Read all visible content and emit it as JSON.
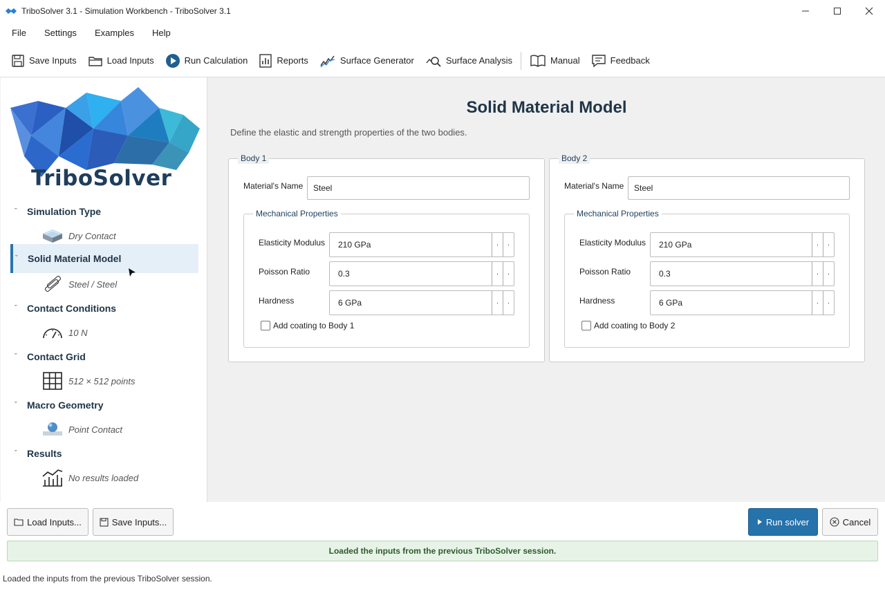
{
  "window": {
    "title": "TriboSolver 3.1 - Simulation Workbench - TriboSolver 3.1"
  },
  "menu": [
    "File",
    "Settings",
    "Examples",
    "Help"
  ],
  "toolbar": {
    "save_inputs": "Save Inputs",
    "load_inputs": "Load Inputs",
    "run_calculation": "Run Calculation",
    "reports": "Reports",
    "surface_generator": "Surface Generator",
    "surface_analysis": "Surface Analysis",
    "manual": "Manual",
    "feedback": "Feedback"
  },
  "logo": {
    "text": "TriboSolver"
  },
  "sidebar": {
    "sections": [
      {
        "label": "Simulation Type",
        "value": "Dry Contact",
        "icon": "contact-block-icon"
      },
      {
        "label": "Solid Material Model",
        "value": "Steel / Steel",
        "icon": "material-bars-icon",
        "active": true
      },
      {
        "label": "Contact Conditions",
        "value": "10 N",
        "icon": "gauge-icon"
      },
      {
        "label": "Contact Grid",
        "value": "512 × 512 points",
        "icon": "grid-icon"
      },
      {
        "label": "Macro Geometry",
        "value": "Point Contact",
        "icon": "sphere-icon"
      },
      {
        "label": "Results",
        "value": "No results loaded",
        "icon": "chart-icon"
      }
    ]
  },
  "main": {
    "title": "Solid Material Model",
    "description": "Define the elastic and strength properties of the two bodies.",
    "bodies": [
      {
        "legend": "Body 1",
        "name_label": "Material's Name",
        "name_value": "Steel",
        "props_legend": "Mechanical Properties",
        "elasticity_label": "Elasticity Modulus",
        "elasticity_value": "210 GPa",
        "poisson_label": "Poisson Ratio",
        "poisson_value": "0.3",
        "hardness_label": "Hardness",
        "hardness_value": "6 GPa",
        "coating_label": "Add coating to Body 1",
        "coating_checked": false
      },
      {
        "legend": "Body 2",
        "name_label": "Material's Name",
        "name_value": "Steel",
        "props_legend": "Mechanical Properties",
        "elasticity_label": "Elasticity Modulus",
        "elasticity_value": "210 GPa",
        "poisson_label": "Poisson Ratio",
        "poisson_value": "0.3",
        "hardness_label": "Hardness",
        "hardness_value": "6 GPa",
        "coating_label": "Add coating to Body 2",
        "coating_checked": false
      }
    ]
  },
  "footer": {
    "load_inputs": "Load Inputs...",
    "save_inputs": "Save Inputs...",
    "run_solver": "Run solver",
    "cancel": "Cancel",
    "banner": "Loaded the inputs from the previous TriboSolver session.",
    "status": "Loaded the inputs from the previous TriboSolver session."
  },
  "colors": {
    "accent": "#2672ab",
    "heading": "#1f3447",
    "banner_bg": "#e8f3e8"
  }
}
